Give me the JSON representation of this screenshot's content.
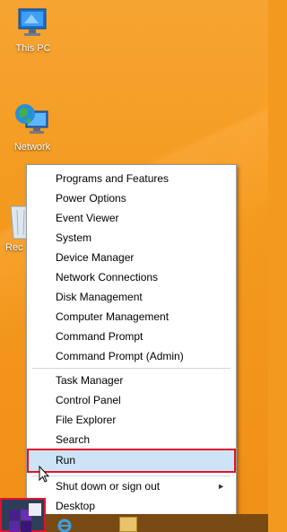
{
  "desktop": {
    "icons": [
      {
        "label": "This PC"
      },
      {
        "label": "Network"
      },
      {
        "label": "Rec"
      }
    ]
  },
  "menu": {
    "groups": [
      [
        "Programs and Features",
        "Power Options",
        "Event Viewer",
        "System",
        "Device Manager",
        "Network Connections",
        "Disk Management",
        "Computer Management",
        "Command Prompt",
        "Command Prompt (Admin)"
      ],
      [
        "Task Manager",
        "Control Panel",
        "File Explorer",
        "Search",
        "Run"
      ],
      [
        "Shut down or sign out",
        "Desktop"
      ]
    ],
    "highlighted": "Run",
    "submenu_arrow": "►"
  },
  "colors": {
    "accent_highlight": "#cde3f6",
    "annotation_red": "#e0142a",
    "desktop_orange": "#f39a1e"
  }
}
